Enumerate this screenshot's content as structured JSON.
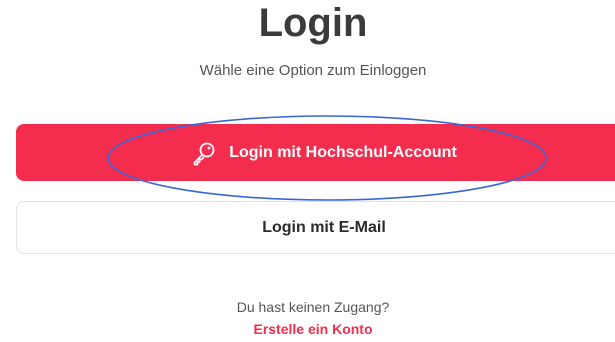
{
  "header": {
    "title": "Login",
    "subtitle": "Wähle eine Option zum Einloggen"
  },
  "options": {
    "hochschul_label": "Login mit Hochschul-Account",
    "hochschul_icon": "key-icon",
    "email_label": "Login mit E-Mail"
  },
  "footer": {
    "no_access_text": "Du hast keinen Zugang?",
    "create_account_link": "Erstelle ein Konto"
  },
  "colors": {
    "accent": "#f42c4e",
    "annotation": "#3a66d8"
  }
}
